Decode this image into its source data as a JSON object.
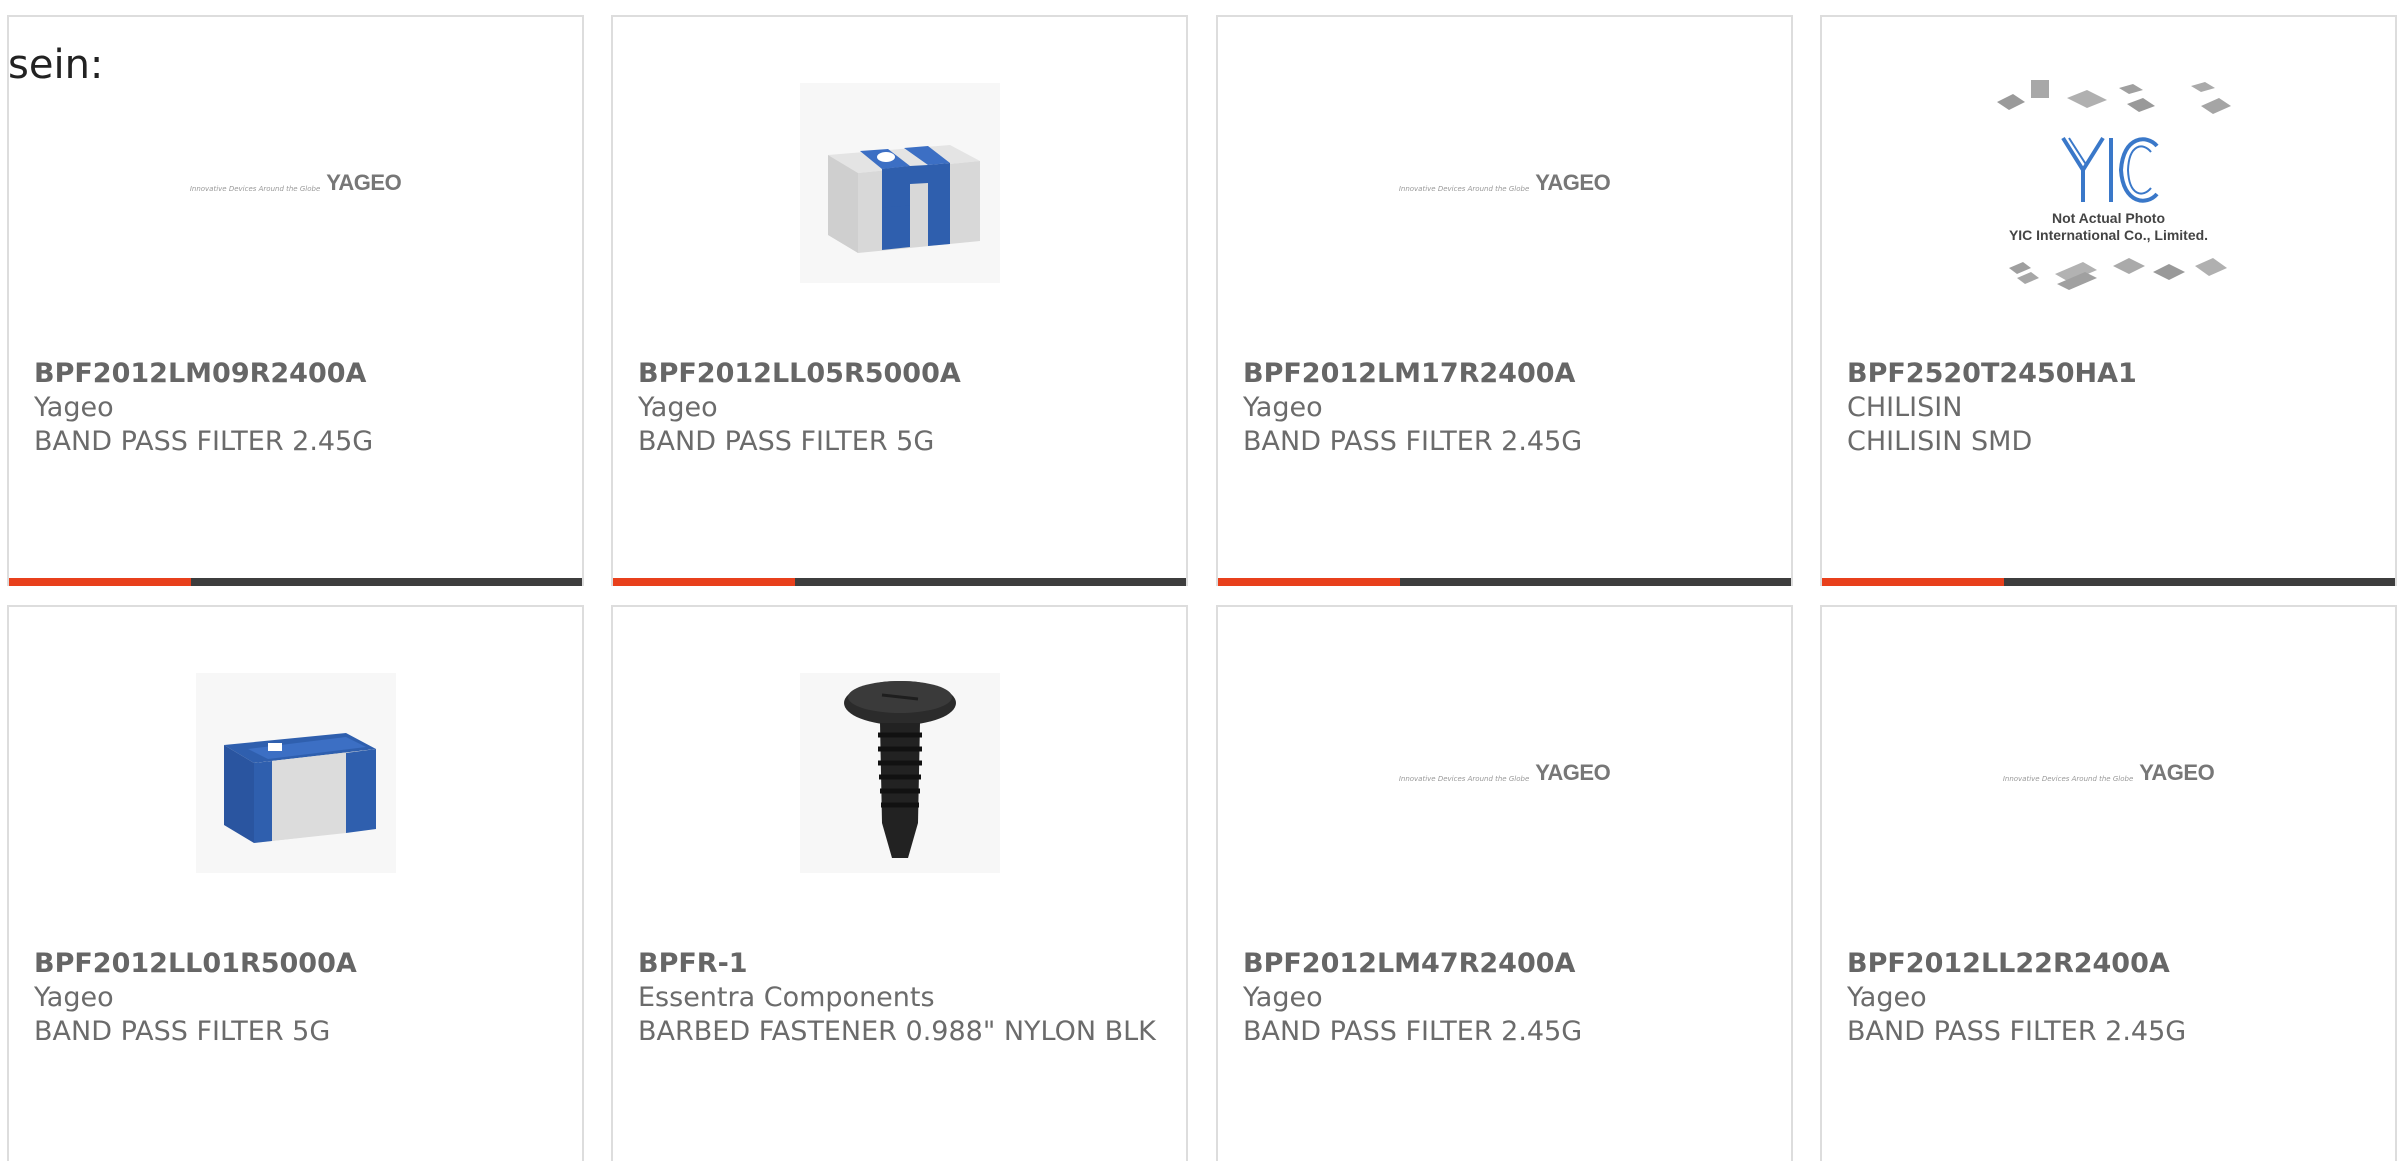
{
  "page": {
    "heading_fragment": "sein:"
  },
  "colors": {
    "accent": "#e8401c",
    "bar_dark": "#3d3d3d",
    "text": "#6b6b6b",
    "border": "#dddddd"
  },
  "products": [
    {
      "part": "BPF2012LM09R2400A",
      "manufacturer": "Yageo",
      "description": "BAND PASS FILTER 2.45G",
      "image": "yageo-logo",
      "logo": {
        "tagline": "Innovative Devices Around the Globe",
        "brand": "YAGEO"
      }
    },
    {
      "part": "BPF2012LL05R5000A",
      "manufacturer": "Yageo",
      "description": "BAND PASS FILTER 5G",
      "image": "chip-component-blue"
    },
    {
      "part": "BPF2012LM17R2400A",
      "manufacturer": "Yageo",
      "description": "BAND PASS FILTER 2.45G",
      "image": "yageo-logo",
      "logo": {
        "tagline": "Innovative Devices Around the Globe",
        "brand": "YAGEO"
      }
    },
    {
      "part": "BPF2520T2450HA1",
      "manufacturer": "CHILISIN",
      "description": "CHILISIN SMD",
      "image": "yic-placeholder",
      "logo": {
        "brand": "YIC",
        "caption_line1": "Not Actual Photo",
        "caption_line2": "YIC International Co., Limited."
      }
    },
    {
      "part": "BPF2012LL01R5000A",
      "manufacturer": "Yageo",
      "description": "BAND PASS FILTER 5G",
      "image": "chip-component-blue"
    },
    {
      "part": "BPFR-1",
      "manufacturer": "Essentra Components",
      "description": "BARBED FASTENER 0.988\" NYLON BLK",
      "image": "barbed-fastener"
    },
    {
      "part": "BPF2012LM47R2400A",
      "manufacturer": "Yageo",
      "description": "BAND PASS FILTER 2.45G",
      "image": "yageo-logo",
      "logo": {
        "tagline": "Innovative Devices Around the Globe",
        "brand": "YAGEO"
      }
    },
    {
      "part": "BPF2012LL22R2400A",
      "manufacturer": "Yageo",
      "description": "BAND PASS FILTER 2.45G",
      "image": "yageo-logo",
      "logo": {
        "tagline": "Innovative Devices Around the Globe",
        "brand": "YAGEO"
      }
    }
  ]
}
